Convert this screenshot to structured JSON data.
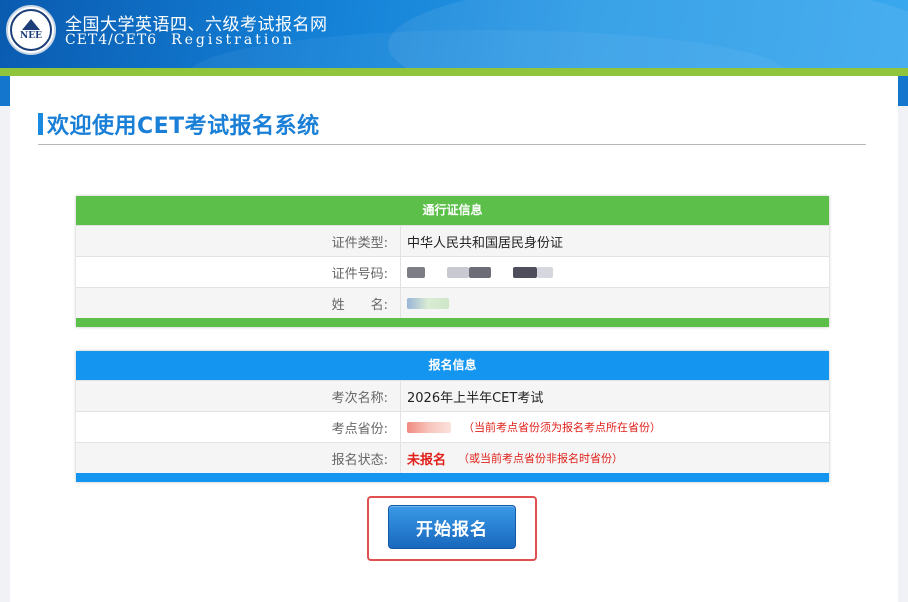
{
  "header": {
    "logo_text": "NEE",
    "title": "全国大学英语四、六级考试报名网",
    "subtitle": "CET4/CET6",
    "subtitle_en": "Registration"
  },
  "page": {
    "heading": "欢迎使用CET考试报名系统"
  },
  "pass_card": {
    "title": "通行证信息",
    "rows": [
      {
        "label": "证件类型:",
        "value": "中华人民共和国居民身份证"
      },
      {
        "label": "证件号码:",
        "value": ""
      },
      {
        "label": "姓　　名:",
        "value": ""
      }
    ]
  },
  "signup_card": {
    "title": "报名信息",
    "rows": [
      {
        "label": "考次名称:",
        "value": "2026年上半年CET考试"
      },
      {
        "label": "考点省份:",
        "value": "",
        "note": "（当前考点省份须为报名考点所在省份）"
      },
      {
        "label": "报名状态:",
        "value": "未报名",
        "note": "（或当前考点省份非报名时省份）"
      }
    ]
  },
  "actions": {
    "start_label": "开始报名"
  },
  "colors": {
    "header_blue": "#1380d6",
    "accent_green": "#5cbf4a",
    "accent_blue": "#1496f0",
    "status_red": "#e0201a"
  }
}
